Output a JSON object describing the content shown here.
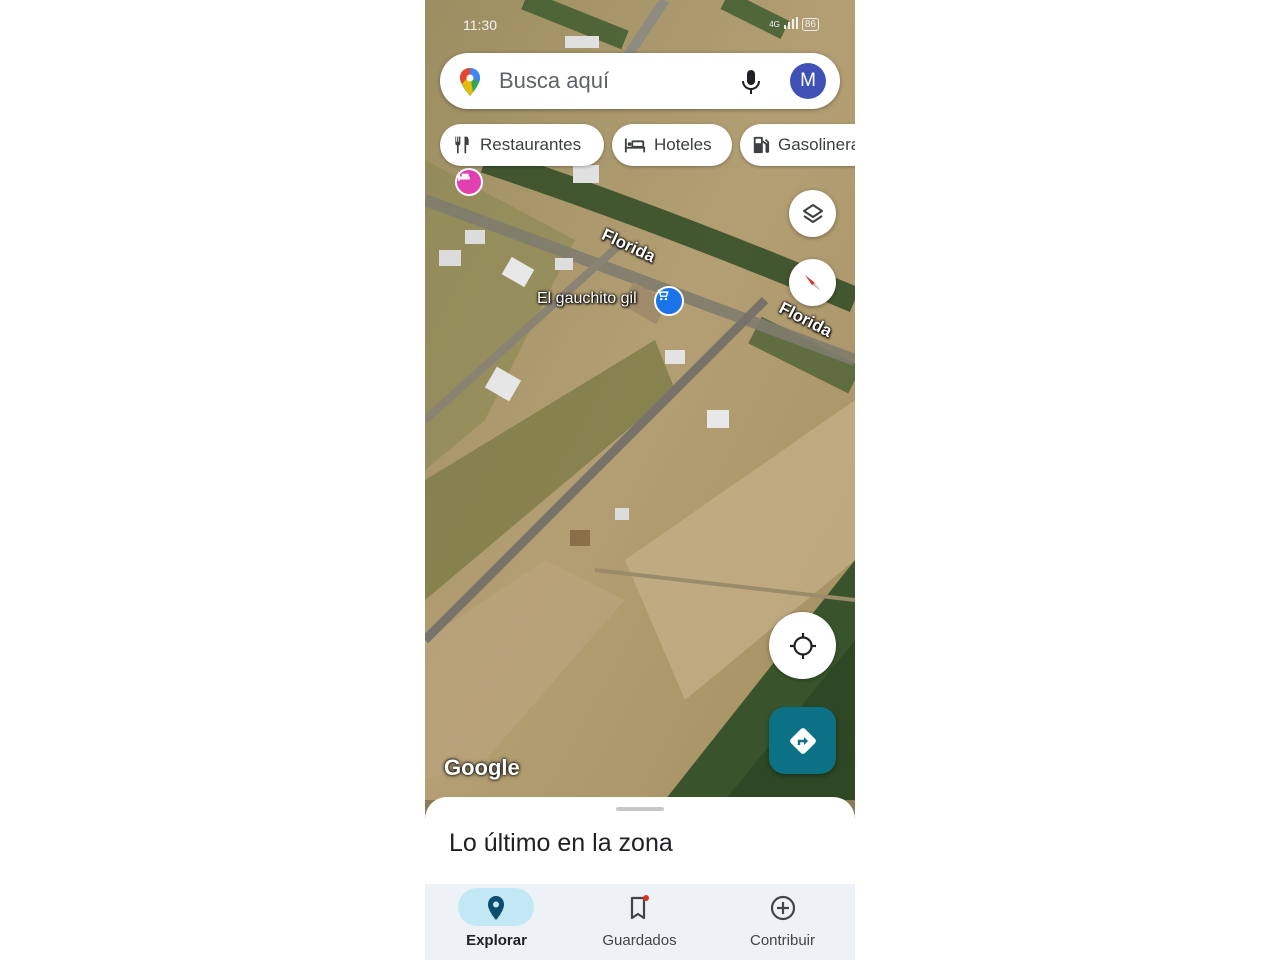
{
  "status_bar": {
    "time": "11:30",
    "network": "4G",
    "battery": "86"
  },
  "search": {
    "placeholder": "Busca aquí",
    "avatar_letter": "M"
  },
  "chips": [
    {
      "label": "Restaurantes",
      "icon": "restaurant-icon"
    },
    {
      "label": "Hoteles",
      "icon": "hotel-icon"
    },
    {
      "label": "Gasolineras",
      "icon": "gas-station-icon"
    }
  ],
  "map": {
    "street_labels": [
      "Florida",
      "Florida"
    ],
    "place_label": "El gauchito gil",
    "attribution": "Google",
    "view": "satellite"
  },
  "sheet": {
    "title": "Lo último en la zona"
  },
  "nav": {
    "items": [
      {
        "label": "Explorar",
        "icon": "explore-pin-icon",
        "active": true
      },
      {
        "label": "Guardados",
        "icon": "bookmark-icon",
        "active": false
      },
      {
        "label": "Contribuir",
        "icon": "add-circle-icon",
        "active": false
      }
    ]
  },
  "colors": {
    "accent_teal": "#0b7285",
    "active_pill": "#c2e7f5",
    "avatar": "#3f51b5"
  }
}
